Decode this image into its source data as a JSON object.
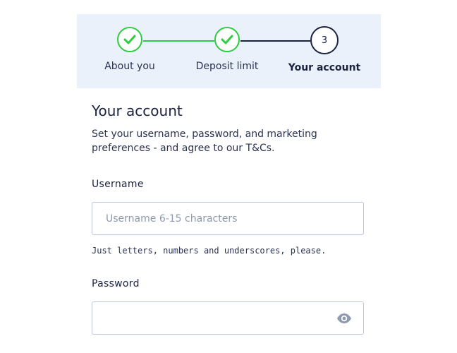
{
  "stepper": {
    "steps": [
      {
        "label": "About you",
        "status": "complete",
        "icon": "check-icon"
      },
      {
        "label": "Deposit limit",
        "status": "complete",
        "icon": "check-icon"
      },
      {
        "label": "Your account",
        "status": "current",
        "number": "3"
      }
    ],
    "colors": {
      "complete": "#2ecc40",
      "current": "#1b2340",
      "panel_bg": "#eaf1fb"
    }
  },
  "form": {
    "title": "Your account",
    "description": "Set your username, password, and marketing preferences - and agree to our T&Cs.",
    "username": {
      "label": "Username",
      "value": "",
      "placeholder": "Username 6-15 characters",
      "hint": "Just letters, numbers and underscores, please."
    },
    "password": {
      "label": "Password",
      "value": "",
      "placeholder": "",
      "toggle_icon": "eye-icon"
    }
  }
}
